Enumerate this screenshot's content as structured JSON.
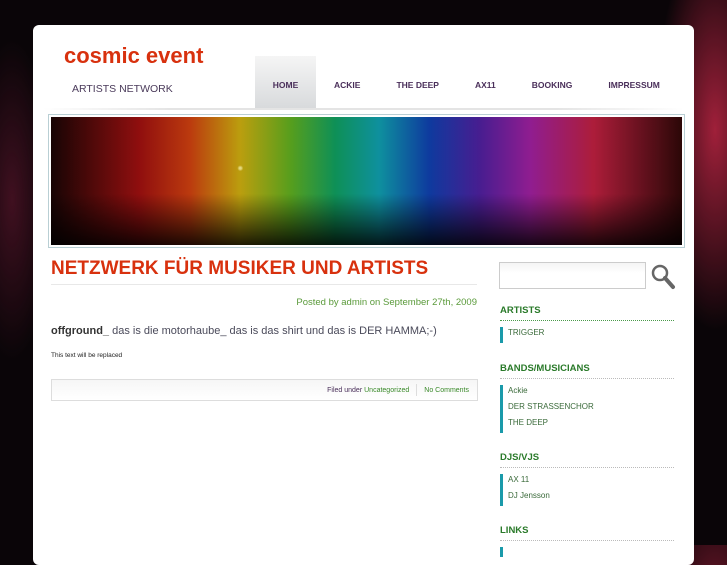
{
  "site": {
    "logo": "cosmic event",
    "tagline": "ARTISTS NETWORK"
  },
  "nav": [
    "HOME",
    "ACKIE",
    "THE DEEP",
    "AX11",
    "BOOKING",
    "IMPRESSUM"
  ],
  "post": {
    "title": "NETZWERK FÜR MUSIKER UND ARTISTS",
    "posted": "Posted by admin on September 27th, 2009",
    "bold": "offground_",
    "text": " das is die motorhaube_ das is das shirt und das is DER HAMMA;-)",
    "small": "This text will be replaced",
    "filed_label": "Filed under",
    "category": "Uncategorized",
    "comments": "No Comments"
  },
  "search": {
    "value": ""
  },
  "sidebar": [
    {
      "title": "ARTISTS",
      "items": [
        "TRIGGER"
      ]
    },
    {
      "title": "BANDS/MUSICIANS",
      "items": [
        "Ackie",
        "DER STRASSENCHOR",
        "THE DEEP"
      ]
    },
    {
      "title": "DJS/VJS",
      "items": [
        "AX 11",
        "DJ Jensson"
      ]
    },
    {
      "title": "LINKS",
      "items": []
    }
  ]
}
